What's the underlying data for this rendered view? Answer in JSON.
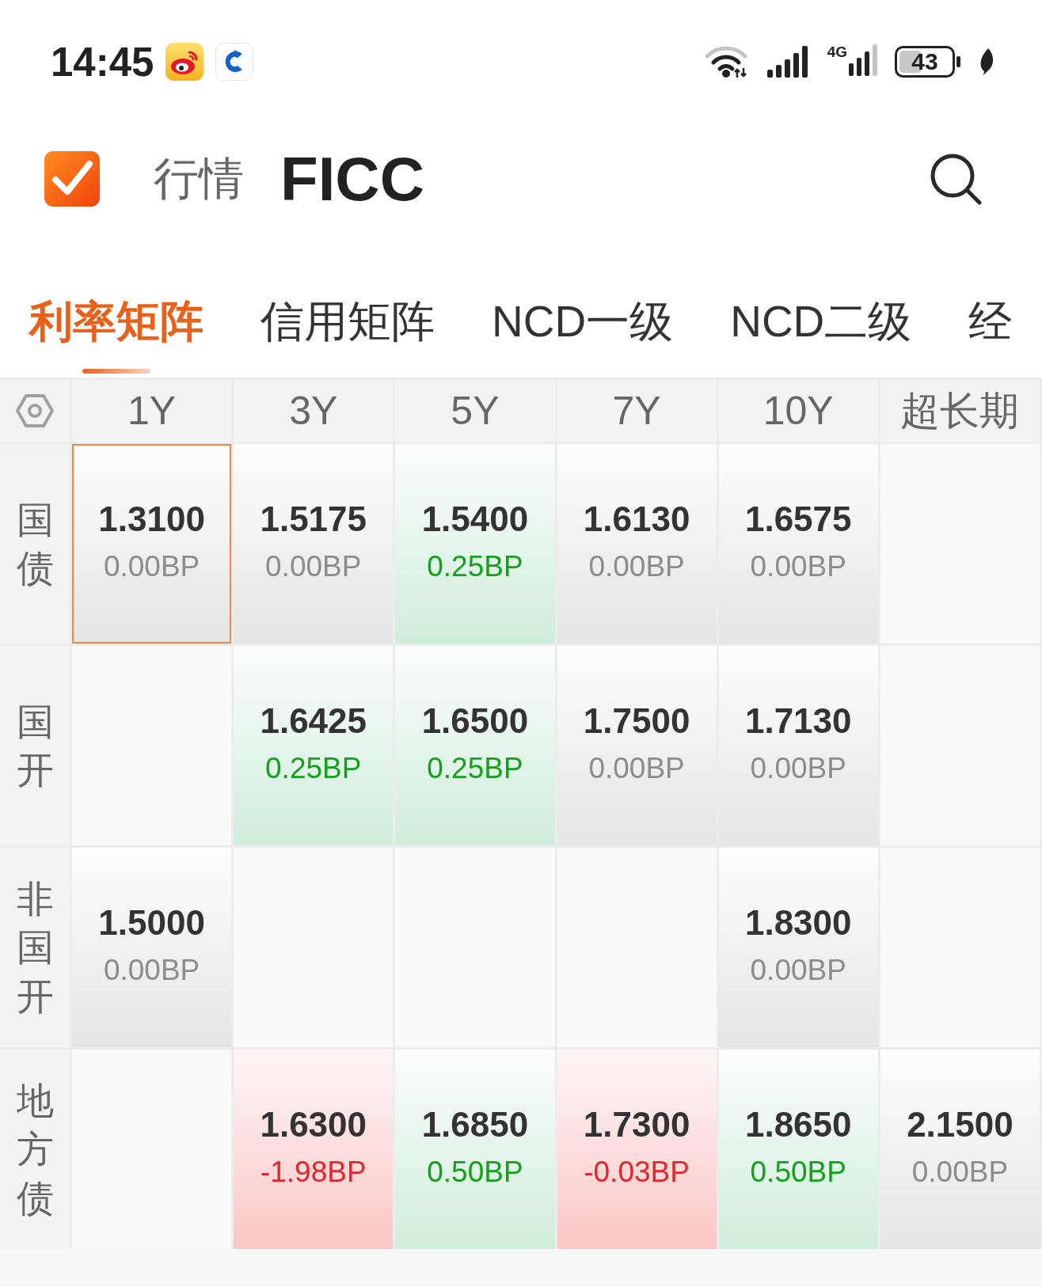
{
  "status_bar": {
    "time": "14:45",
    "network": "4G",
    "battery": "43"
  },
  "header": {
    "section": "行情",
    "title": "FICC"
  },
  "tabs": [
    {
      "label": "利率矩阵",
      "selected": true
    },
    {
      "label": "信用矩阵",
      "selected": false
    },
    {
      "label": "NCD一级",
      "selected": false
    },
    {
      "label": "NCD二级",
      "selected": false
    },
    {
      "label": "经",
      "selected": false
    }
  ],
  "matrix": {
    "columns": [
      "1Y",
      "3Y",
      "5Y",
      "7Y",
      "10Y",
      "超长期"
    ],
    "rows": [
      {
        "label": "国债",
        "cells": [
          {
            "kind": "flat",
            "rate": "1.3100",
            "change": "0.00BP",
            "selected": true
          },
          {
            "kind": "flat",
            "rate": "1.5175",
            "change": "0.00BP",
            "selected": false
          },
          {
            "kind": "rise",
            "rate": "1.5400",
            "change": "0.25BP",
            "selected": false
          },
          {
            "kind": "flat",
            "rate": "1.6130",
            "change": "0.00BP",
            "selected": false
          },
          {
            "kind": "flat",
            "rate": "1.6575",
            "change": "0.00BP",
            "selected": false
          },
          {
            "kind": "empty",
            "selected": false
          }
        ]
      },
      {
        "label": "国开",
        "cells": [
          {
            "kind": "empty",
            "selected": false
          },
          {
            "kind": "rise",
            "rate": "1.6425",
            "change": "0.25BP",
            "selected": false
          },
          {
            "kind": "rise",
            "rate": "1.6500",
            "change": "0.25BP",
            "selected": false
          },
          {
            "kind": "flat",
            "rate": "1.7500",
            "change": "0.00BP",
            "selected": false
          },
          {
            "kind": "flat",
            "rate": "1.7130",
            "change": "0.00BP",
            "selected": false
          },
          {
            "kind": "empty",
            "selected": false
          }
        ]
      },
      {
        "label": "非国开",
        "cells": [
          {
            "kind": "flat",
            "rate": "1.5000",
            "change": "0.00BP",
            "selected": false
          },
          {
            "kind": "empty",
            "selected": false
          },
          {
            "kind": "empty",
            "selected": false
          },
          {
            "kind": "empty",
            "selected": false
          },
          {
            "kind": "flat",
            "rate": "1.8300",
            "change": "0.00BP",
            "selected": false
          },
          {
            "kind": "empty",
            "selected": false
          }
        ]
      },
      {
        "label": "地方债",
        "cells": [
          {
            "kind": "empty",
            "selected": false
          },
          {
            "kind": "fall",
            "rate": "1.6300",
            "change": "-1.98BP",
            "selected": false
          },
          {
            "kind": "rise",
            "rate": "1.6850",
            "change": "0.50BP",
            "selected": false
          },
          {
            "kind": "fall",
            "rate": "1.7300",
            "change": "-0.03BP",
            "selected": false
          },
          {
            "kind": "rise",
            "rate": "1.8650",
            "change": "0.50BP",
            "selected": false
          },
          {
            "kind": "flat",
            "rate": "2.1500",
            "change": "0.00BP",
            "selected": false
          }
        ]
      }
    ]
  }
}
